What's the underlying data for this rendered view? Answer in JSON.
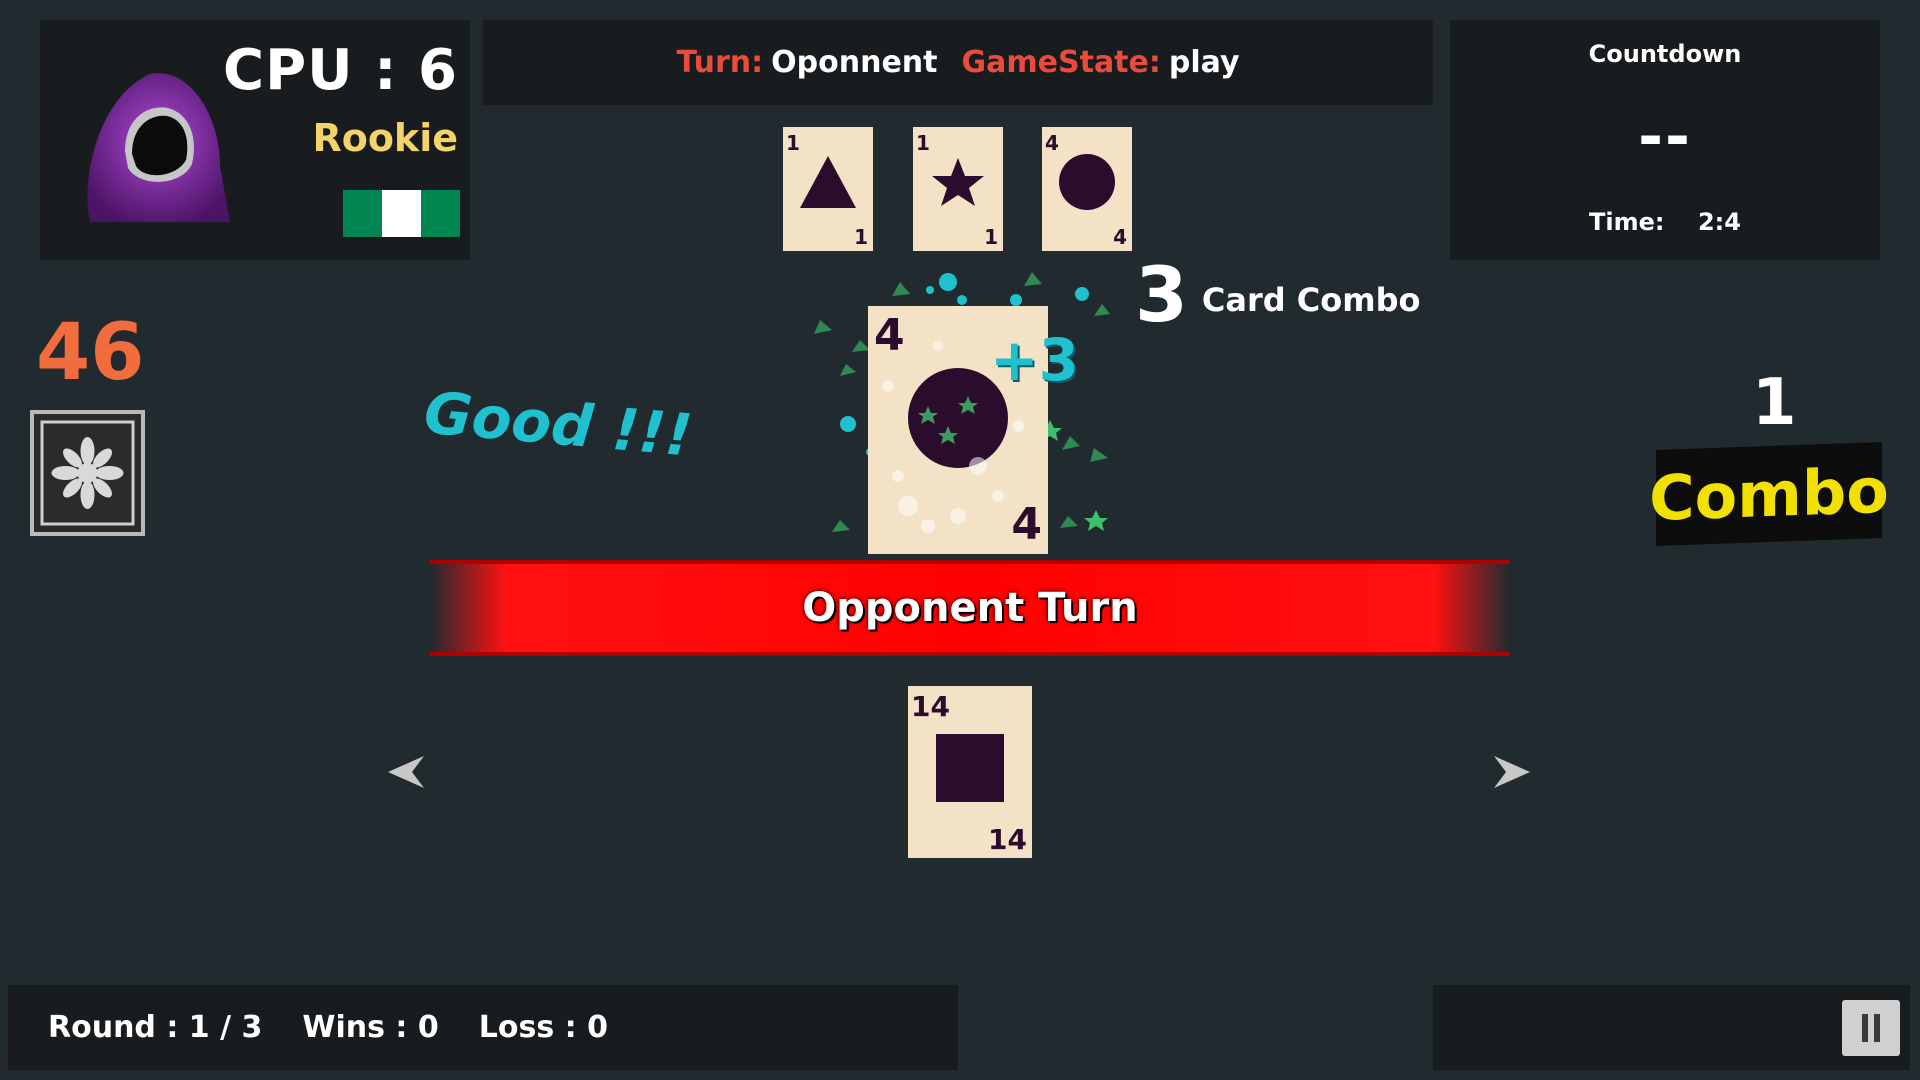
{
  "opponent": {
    "score_text": "CPU : 6",
    "rank": "Rookie",
    "flag_colors": [
      "#008751",
      "#ffffff",
      "#008751"
    ]
  },
  "status": {
    "turn_label": "Turn:",
    "turn_value": "Oponnent",
    "state_label": "GameState:",
    "state_value": "play"
  },
  "countdown": {
    "title": "Countdown",
    "value": "--",
    "time_label": "Time:",
    "time_value": "2:4"
  },
  "combo_cards": [
    {
      "rank": "1",
      "shape": "triangle-icon"
    },
    {
      "rank": "1",
      "shape": "star-icon"
    },
    {
      "rank": "4",
      "shape": "circle-icon"
    }
  ],
  "combo": {
    "count": "3",
    "label": "Card Combo",
    "plus": "+3",
    "feedback": "Good !!!"
  },
  "player_score": "46",
  "played_card": {
    "rank": "4",
    "shape": "circle-icon"
  },
  "right_combo": {
    "count": "1",
    "word": "Combo"
  },
  "turn_banner": "Opponent Turn",
  "hand_card": {
    "rank": "14",
    "shape": "square-icon"
  },
  "footer": {
    "round": "Round : 1 / 3",
    "wins": "Wins : 0",
    "loss": "Loss : 0"
  },
  "colors": {
    "background": "#202a2f",
    "panel": "#181c1e",
    "card": "#f3e2c6",
    "card_ink": "#2a0c2c",
    "accent_red": "#ea4c3b",
    "score_orange": "#f26d3d",
    "rank_yellow": "#f4d36a",
    "combo_cyan": "#1fc1cf",
    "combo_yellow": "#f2e000"
  }
}
